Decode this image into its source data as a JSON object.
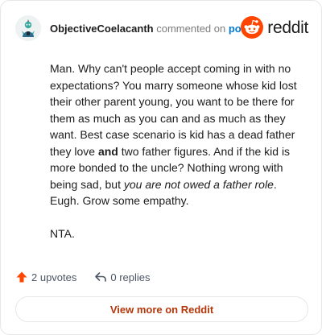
{
  "header": {
    "username": "ObjectiveCoelacanth",
    "action_text": "commented on",
    "post_link": "post",
    "logo_text": "reddit"
  },
  "comment": {
    "paragraph1": {
      "part1": "Man. Why can't people accept coming in with no expectations? You marry someone whose kid lost their other parent young, you want to be there for them as much as you can and as much as they want. Best case scenario is kid has a dead father they love ",
      "bold": "and",
      "part2": " two father figures. And if the kid is more bonded to the uncle? Nothing wrong with being sad, but ",
      "italic": "you are not owed a father role",
      "part3": ". Eugh. Grow some empathy."
    },
    "paragraph2": "NTA."
  },
  "footer": {
    "upvotes": "2 upvotes",
    "replies": "0 replies"
  },
  "view_more_label": "View more on Reddit",
  "colors": {
    "accent": "#0079d3",
    "upvote": "#ff4500",
    "view_more": "#b4370a"
  }
}
